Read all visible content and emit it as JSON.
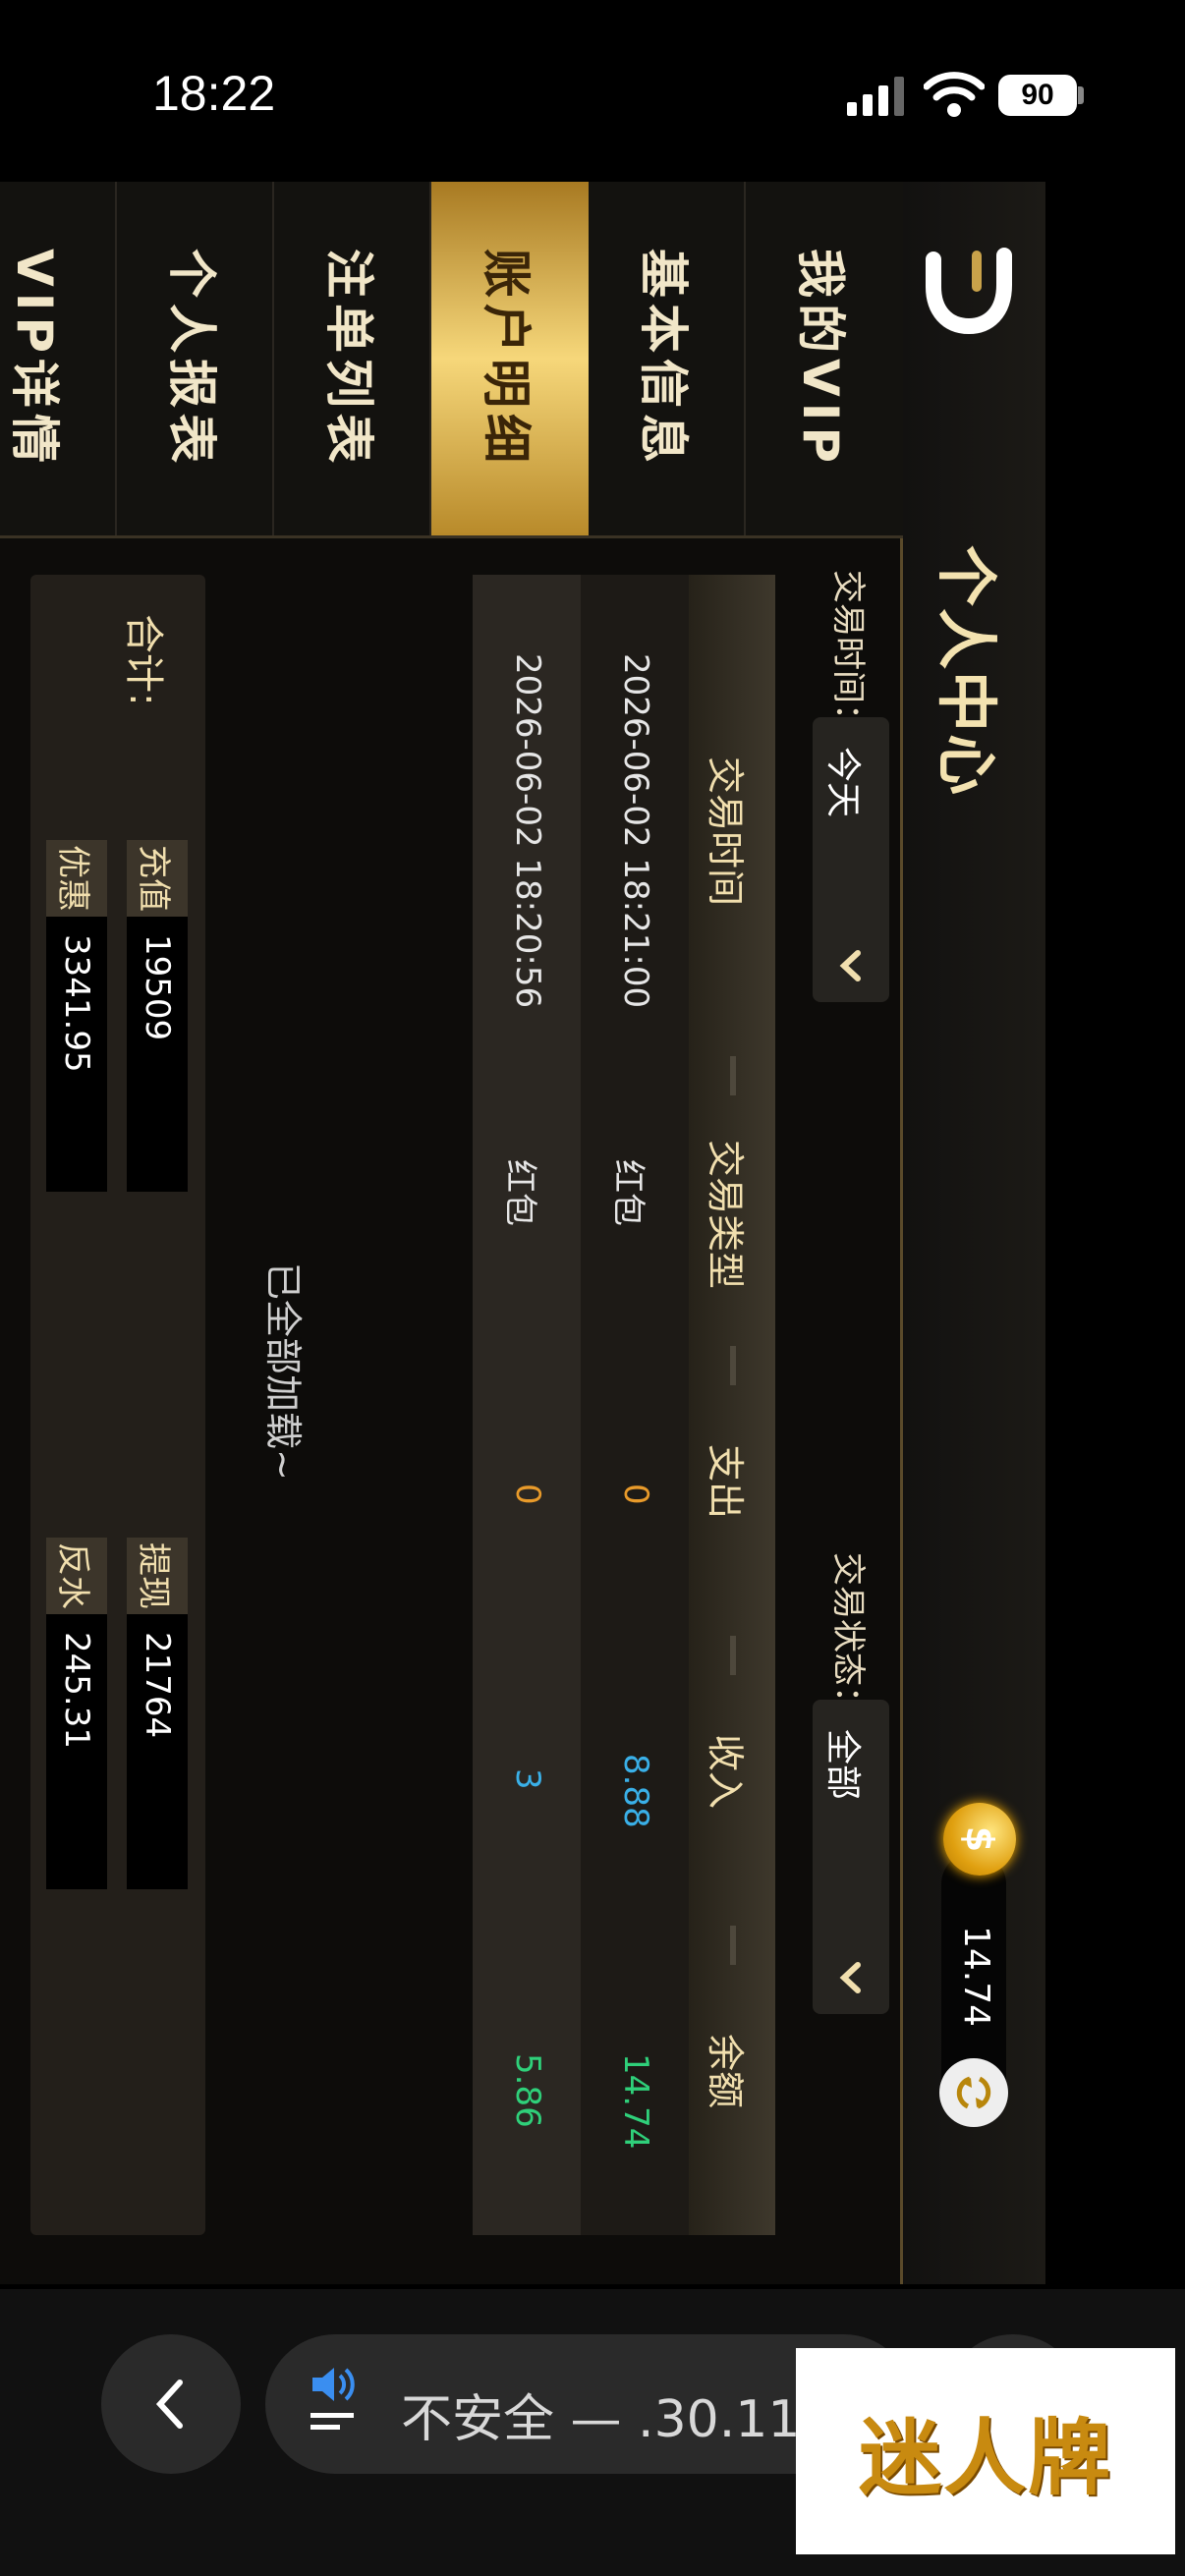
{
  "status_bar": {
    "time": "18:22",
    "battery": "90"
  },
  "header": {
    "title": "个人中心",
    "balance": "14.74"
  },
  "sidebar": {
    "items": [
      {
        "label": "我的VIP"
      },
      {
        "label": "基本信息"
      },
      {
        "label": "账户明细"
      },
      {
        "label": "注单列表"
      },
      {
        "label": "个人报表"
      },
      {
        "label": "VIP详情"
      }
    ],
    "active": "账户明细"
  },
  "filters": {
    "time_label": "交易时间：",
    "time_value": "今天",
    "status_label": "交易状态：",
    "status_value": "全部"
  },
  "table": {
    "headers": [
      "交易时间",
      "交易类型",
      "支出",
      "收入",
      "余额"
    ],
    "rows": [
      {
        "time": "2026-06-02 18:21:00",
        "type": "红包",
        "expense": "0",
        "income": "8.88",
        "balance": "14.74"
      },
      {
        "time": "2026-06-02 18:20:56",
        "type": "红包",
        "expense": "0",
        "income": "3",
        "balance": "5.86"
      }
    ]
  },
  "loaded_text": "已全部加载~",
  "summary": {
    "label": "合计:",
    "items": [
      {
        "tag": "充值",
        "value": "19509"
      },
      {
        "tag": "提现",
        "value": "21764"
      },
      {
        "tag": "优惠",
        "value": "3341.95"
      },
      {
        "tag": "反水",
        "value": "245.31"
      }
    ]
  },
  "browser": {
    "url_text": "不安全 — .30.114"
  },
  "watermark": "迷人牌",
  "colors": {
    "gold": "#f1dfae",
    "expense": "#e89a2a",
    "income": "#3ab0e8",
    "balance": "#2fd07a"
  }
}
